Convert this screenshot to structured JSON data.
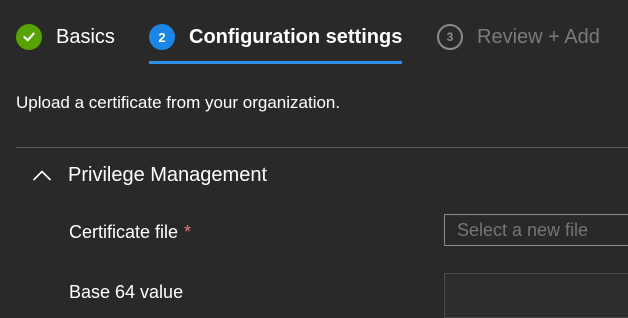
{
  "wizard": {
    "steps": [
      {
        "label": "Basics",
        "icon": "checkmark-icon",
        "state": "completed",
        "color": "#57a300"
      },
      {
        "label": "Configuration settings",
        "number": "2",
        "state": "current",
        "color": "#1b86e6"
      },
      {
        "label": "Review + Add",
        "number": "3",
        "state": "upcoming"
      }
    ]
  },
  "description": "Upload a certificate from your organization.",
  "section": {
    "title": "Privilege Management",
    "icon": "chevron-up-icon"
  },
  "fields": {
    "certificate": {
      "label": "Certificate file",
      "required_marker": "*",
      "placeholder": "Select a new file"
    },
    "base64": {
      "label": "Base 64 value",
      "value": ""
    }
  }
}
